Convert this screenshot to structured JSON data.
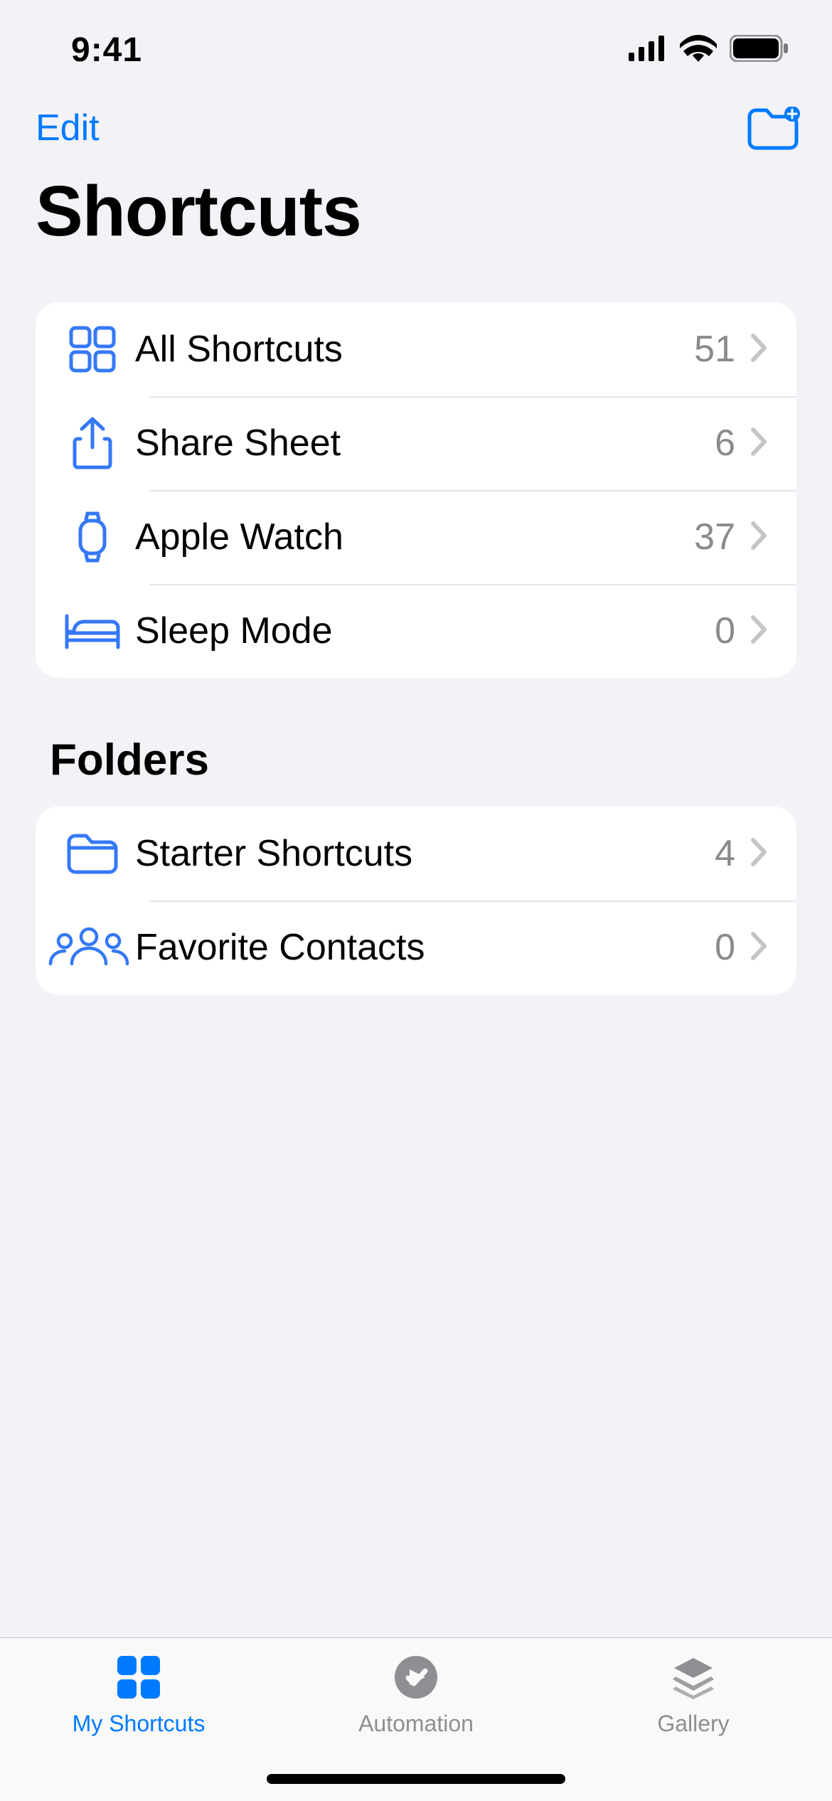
{
  "status": {
    "time": "9:41"
  },
  "nav": {
    "edit": "Edit"
  },
  "title": "Shortcuts",
  "categories": [
    {
      "icon": "grid",
      "label": "All Shortcuts",
      "count": "51"
    },
    {
      "icon": "share",
      "label": "Share Sheet",
      "count": "6"
    },
    {
      "icon": "watch",
      "label": "Apple Watch",
      "count": "37"
    },
    {
      "icon": "bed",
      "label": "Sleep Mode",
      "count": "0"
    }
  ],
  "folders_header": "Folders",
  "folders": [
    {
      "icon": "folder",
      "label": "Starter Shortcuts",
      "count": "4"
    },
    {
      "icon": "people",
      "label": "Favorite Contacts",
      "count": "0"
    }
  ],
  "tabs": {
    "my_shortcuts": "My Shortcuts",
    "automation": "Automation",
    "gallery": "Gallery"
  }
}
